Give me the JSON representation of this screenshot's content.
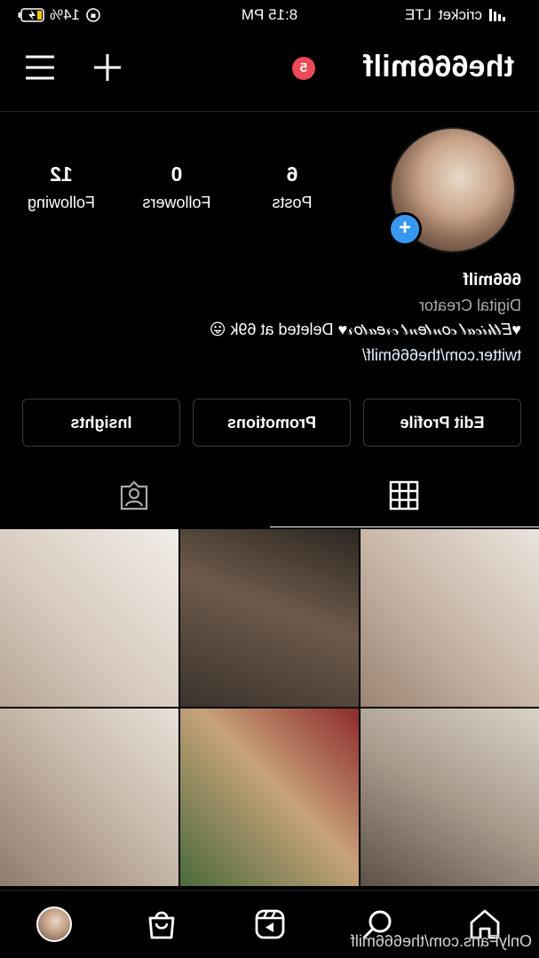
{
  "status_bar": {
    "carrier": "cricket",
    "network": "LTE",
    "time": "8:15 PM",
    "battery": "14%"
  },
  "header": {
    "username": "the666milf",
    "notification_count": "5",
    "plus_icon": "plus-icon",
    "menu_icon": "hamburger-menu-icon"
  },
  "profile": {
    "stats": [
      {
        "value": "6",
        "label": "Posts"
      },
      {
        "value": "0",
        "label": "Followers"
      },
      {
        "value": "12",
        "label": "Following"
      }
    ],
    "name": "666milf",
    "category": "Digital Creator",
    "bio": "♥𝐸𝓉𝒽𝒾𝒸𝒶𝓁 𝒸𝑜𝓃𝓉𝑒𝓃𝓉 𝒸𝓇𝑒𝒶𝓉𝑜𝓇♥ Deleted at 69k 😛",
    "link": "twitter.com/the666milf/"
  },
  "buttons": {
    "edit_profile": "Edit Profile",
    "promotions": "Promotions",
    "insights": "Insights"
  },
  "tabs": [
    {
      "name": "grid",
      "icon": "grid-icon",
      "selected": true
    },
    {
      "name": "tagged",
      "icon": "tagged-person-icon",
      "selected": false
    }
  ],
  "photos_count_visible": 6,
  "bottom_nav": [
    {
      "icon": "home-icon"
    },
    {
      "icon": "search-icon"
    },
    {
      "icon": "reels-icon"
    },
    {
      "icon": "shop-bag-icon"
    },
    {
      "icon": "profile-avatar"
    }
  ],
  "watermark": "OnlyFans.com/the666milf",
  "colors": {
    "background": "#000000",
    "badge": "#ed4956",
    "accent_blue": "#3897f0",
    "secondary_text": "#a8a8a8",
    "border": "#3a3a3a"
  }
}
